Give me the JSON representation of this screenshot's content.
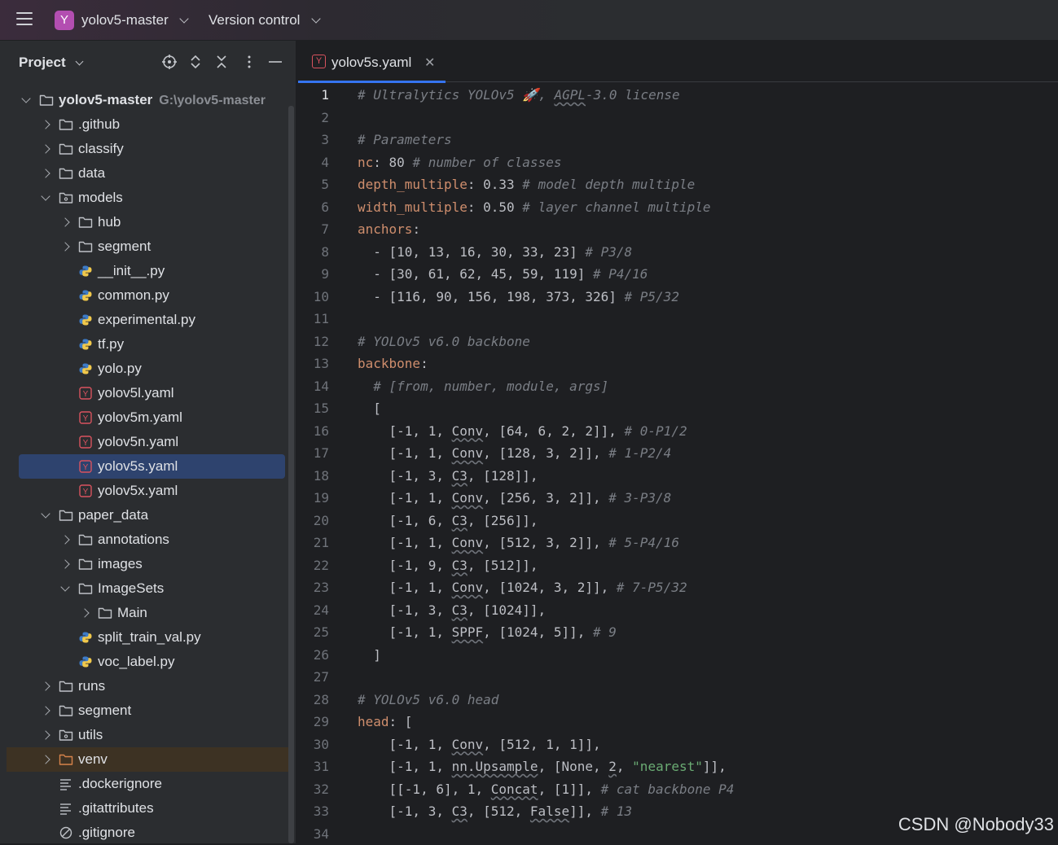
{
  "titlebar": {
    "project_badge": "Y",
    "project_name": "yolov5-master",
    "vcs_label": "Version control"
  },
  "project_panel": {
    "title": "Project",
    "tree": [
      {
        "label": "yolov5-master",
        "path": "G:\\yolov5-master",
        "depth": 0,
        "kind": "folder",
        "state": "expanded",
        "bold": true
      },
      {
        "label": ".github",
        "depth": 1,
        "kind": "folder",
        "state": "collapsed"
      },
      {
        "label": "classify",
        "depth": 1,
        "kind": "folder",
        "state": "collapsed"
      },
      {
        "label": "data",
        "depth": 1,
        "kind": "folder",
        "state": "collapsed"
      },
      {
        "label": "models",
        "depth": 1,
        "kind": "package",
        "state": "expanded"
      },
      {
        "label": "hub",
        "depth": 2,
        "kind": "folder",
        "state": "collapsed"
      },
      {
        "label": "segment",
        "depth": 2,
        "kind": "folder",
        "state": "collapsed"
      },
      {
        "label": "__init__.py",
        "depth": 2,
        "kind": "python"
      },
      {
        "label": "common.py",
        "depth": 2,
        "kind": "python"
      },
      {
        "label": "experimental.py",
        "depth": 2,
        "kind": "python"
      },
      {
        "label": "tf.py",
        "depth": 2,
        "kind": "python"
      },
      {
        "label": "yolo.py",
        "depth": 2,
        "kind": "python"
      },
      {
        "label": "yolov5l.yaml",
        "depth": 2,
        "kind": "yaml"
      },
      {
        "label": "yolov5m.yaml",
        "depth": 2,
        "kind": "yaml"
      },
      {
        "label": "yolov5n.yaml",
        "depth": 2,
        "kind": "yaml"
      },
      {
        "label": "yolov5s.yaml",
        "depth": 2,
        "kind": "yaml",
        "selected": true
      },
      {
        "label": "yolov5x.yaml",
        "depth": 2,
        "kind": "yaml"
      },
      {
        "label": "paper_data",
        "depth": 1,
        "kind": "folder",
        "state": "expanded"
      },
      {
        "label": "annotations",
        "depth": 2,
        "kind": "folder",
        "state": "collapsed"
      },
      {
        "label": "images",
        "depth": 2,
        "kind": "folder",
        "state": "collapsed"
      },
      {
        "label": "ImageSets",
        "depth": 2,
        "kind": "folder",
        "state": "expanded"
      },
      {
        "label": "Main",
        "depth": 3,
        "kind": "folder",
        "state": "collapsed"
      },
      {
        "label": "split_train_val.py",
        "depth": 2,
        "kind": "python"
      },
      {
        "label": "voc_label.py",
        "depth": 2,
        "kind": "python"
      },
      {
        "label": "runs",
        "depth": 1,
        "kind": "folder",
        "state": "collapsed"
      },
      {
        "label": "segment",
        "depth": 1,
        "kind": "folder",
        "state": "collapsed"
      },
      {
        "label": "utils",
        "depth": 1,
        "kind": "package",
        "state": "collapsed"
      },
      {
        "label": "venv",
        "depth": 1,
        "kind": "folder-excluded",
        "state": "collapsed",
        "highlight": true
      },
      {
        "label": ".dockerignore",
        "depth": 1,
        "kind": "text"
      },
      {
        "label": ".gitattributes",
        "depth": 1,
        "kind": "text"
      },
      {
        "label": ".gitignore",
        "depth": 1,
        "kind": "ignore"
      }
    ]
  },
  "editor": {
    "tab_label": "yolov5s.yaml",
    "tab_icon": "Y",
    "current_line": 1,
    "lines": [
      {
        "n": "1",
        "t": [
          [
            "c",
            "# Ultralytics YOLOv5 🚀, "
          ],
          [
            "cu",
            "AGPL"
          ],
          [
            "c",
            "-3.0 license"
          ]
        ]
      },
      {
        "n": "2",
        "t": []
      },
      {
        "n": "3",
        "t": [
          [
            "c",
            "# Parameters"
          ]
        ]
      },
      {
        "n": "4",
        "t": [
          [
            "k",
            "nc"
          ],
          [
            "p",
            ": "
          ],
          [
            "p",
            "80"
          ],
          [
            "p",
            " "
          ],
          [
            "c",
            "# number of classes"
          ]
        ]
      },
      {
        "n": "5",
        "t": [
          [
            "k",
            "depth_multiple"
          ],
          [
            "p",
            ": "
          ],
          [
            "p",
            "0.33"
          ],
          [
            "p",
            " "
          ],
          [
            "c",
            "# model depth multiple"
          ]
        ]
      },
      {
        "n": "6",
        "t": [
          [
            "k",
            "width_multiple"
          ],
          [
            "p",
            ": "
          ],
          [
            "p",
            "0.50"
          ],
          [
            "p",
            " "
          ],
          [
            "c",
            "# layer channel multiple"
          ]
        ]
      },
      {
        "n": "7",
        "t": [
          [
            "k",
            "anchors"
          ],
          [
            "p",
            ":"
          ]
        ]
      },
      {
        "n": "8",
        "t": [
          [
            "p",
            "  - [10, 13, 16, 30, 33, 23] "
          ],
          [
            "c",
            "# P3/8"
          ]
        ]
      },
      {
        "n": "9",
        "t": [
          [
            "p",
            "  - [30, 61, 62, 45, 59, 119] "
          ],
          [
            "c",
            "# P4/16"
          ]
        ]
      },
      {
        "n": "10",
        "t": [
          [
            "p",
            "  - [116, 90, 156, 198, 373, 326] "
          ],
          [
            "c",
            "# P5/32"
          ]
        ]
      },
      {
        "n": "11",
        "t": []
      },
      {
        "n": "12",
        "t": [
          [
            "c",
            "# YOLOv5 v6.0 backbone"
          ]
        ]
      },
      {
        "n": "13",
        "t": [
          [
            "k",
            "backbone"
          ],
          [
            "p",
            ":"
          ]
        ]
      },
      {
        "n": "14",
        "t": [
          [
            "p",
            "  "
          ],
          [
            "c",
            "# [from, number, module, args]"
          ]
        ]
      },
      {
        "n": "15",
        "t": [
          [
            "p",
            "  ["
          ]
        ]
      },
      {
        "n": "16",
        "t": [
          [
            "p",
            "    [-1, 1, "
          ],
          [
            "u",
            "Conv"
          ],
          [
            "p",
            ", [64, 6, 2, 2]], "
          ],
          [
            "c",
            "# 0-P1/2"
          ]
        ]
      },
      {
        "n": "17",
        "t": [
          [
            "p",
            "    [-1, 1, "
          ],
          [
            "u",
            "Conv"
          ],
          [
            "p",
            ", [128, 3, 2]], "
          ],
          [
            "c",
            "# 1-P2/4"
          ]
        ]
      },
      {
        "n": "18",
        "t": [
          [
            "p",
            "    [-1, 3, "
          ],
          [
            "u",
            "C3"
          ],
          [
            "p",
            ", [128]],"
          ]
        ]
      },
      {
        "n": "19",
        "t": [
          [
            "p",
            "    [-1, 1, "
          ],
          [
            "u",
            "Conv"
          ],
          [
            "p",
            ", [256, 3, 2]], "
          ],
          [
            "c",
            "# 3-P3/8"
          ]
        ]
      },
      {
        "n": "20",
        "t": [
          [
            "p",
            "    [-1, 6, "
          ],
          [
            "u",
            "C3"
          ],
          [
            "p",
            ", [256]],"
          ]
        ]
      },
      {
        "n": "21",
        "t": [
          [
            "p",
            "    [-1, 1, "
          ],
          [
            "u",
            "Conv"
          ],
          [
            "p",
            ", [512, 3, 2]], "
          ],
          [
            "c",
            "# 5-P4/16"
          ]
        ]
      },
      {
        "n": "22",
        "t": [
          [
            "p",
            "    [-1, 9, "
          ],
          [
            "u",
            "C3"
          ],
          [
            "p",
            ", [512]],"
          ]
        ]
      },
      {
        "n": "23",
        "t": [
          [
            "p",
            "    [-1, 1, "
          ],
          [
            "u",
            "Conv"
          ],
          [
            "p",
            ", [1024, 3, 2]], "
          ],
          [
            "c",
            "# 7-P5/32"
          ]
        ]
      },
      {
        "n": "24",
        "t": [
          [
            "p",
            "    [-1, 3, "
          ],
          [
            "u",
            "C3"
          ],
          [
            "p",
            ", [1024]],"
          ]
        ]
      },
      {
        "n": "25",
        "t": [
          [
            "p",
            "    [-1, 1, "
          ],
          [
            "u",
            "SPPF"
          ],
          [
            "p",
            ", [1024, 5]], "
          ],
          [
            "c",
            "# 9"
          ]
        ]
      },
      {
        "n": "26",
        "t": [
          [
            "p",
            "  ]"
          ]
        ]
      },
      {
        "n": "27",
        "t": []
      },
      {
        "n": "28",
        "t": [
          [
            "c",
            "# YOLOv5 v6.0 head"
          ]
        ]
      },
      {
        "n": "29",
        "t": [
          [
            "k",
            "head"
          ],
          [
            "p",
            ": ["
          ]
        ]
      },
      {
        "n": "30",
        "t": [
          [
            "p",
            "    [-1, 1, "
          ],
          [
            "u",
            "Conv"
          ],
          [
            "p",
            ", [512, 1, 1]],"
          ]
        ]
      },
      {
        "n": "31",
        "t": [
          [
            "p",
            "    [-1, 1, "
          ],
          [
            "u",
            "nn.Upsample"
          ],
          [
            "p",
            ", [None, "
          ],
          [
            "u",
            "2"
          ],
          [
            "p",
            ", "
          ],
          [
            "s",
            "\"nearest\""
          ],
          [
            "p",
            "]],"
          ]
        ]
      },
      {
        "n": "32",
        "t": [
          [
            "p",
            "    [[-1, 6], 1, "
          ],
          [
            "u",
            "Concat"
          ],
          [
            "p",
            ", [1]], "
          ],
          [
            "c",
            "# cat backbone P4"
          ]
        ]
      },
      {
        "n": "33",
        "t": [
          [
            "p",
            "    [-1, 3, "
          ],
          [
            "u",
            "C3"
          ],
          [
            "p",
            ", [512, "
          ],
          [
            "u",
            "False"
          ],
          [
            "p",
            "]], "
          ],
          [
            "c",
            "# 13"
          ]
        ]
      },
      {
        "n": "34",
        "t": []
      }
    ]
  },
  "watermark": "CSDN @Nobody33",
  "colors": {
    "accent": "#3574f0",
    "selection": "#2e436e",
    "comment": "#7a7e85",
    "key": "#cf8e6d",
    "string": "#6aab73",
    "badge": "#b34eb1",
    "yaml_icon": "#d9535f"
  }
}
